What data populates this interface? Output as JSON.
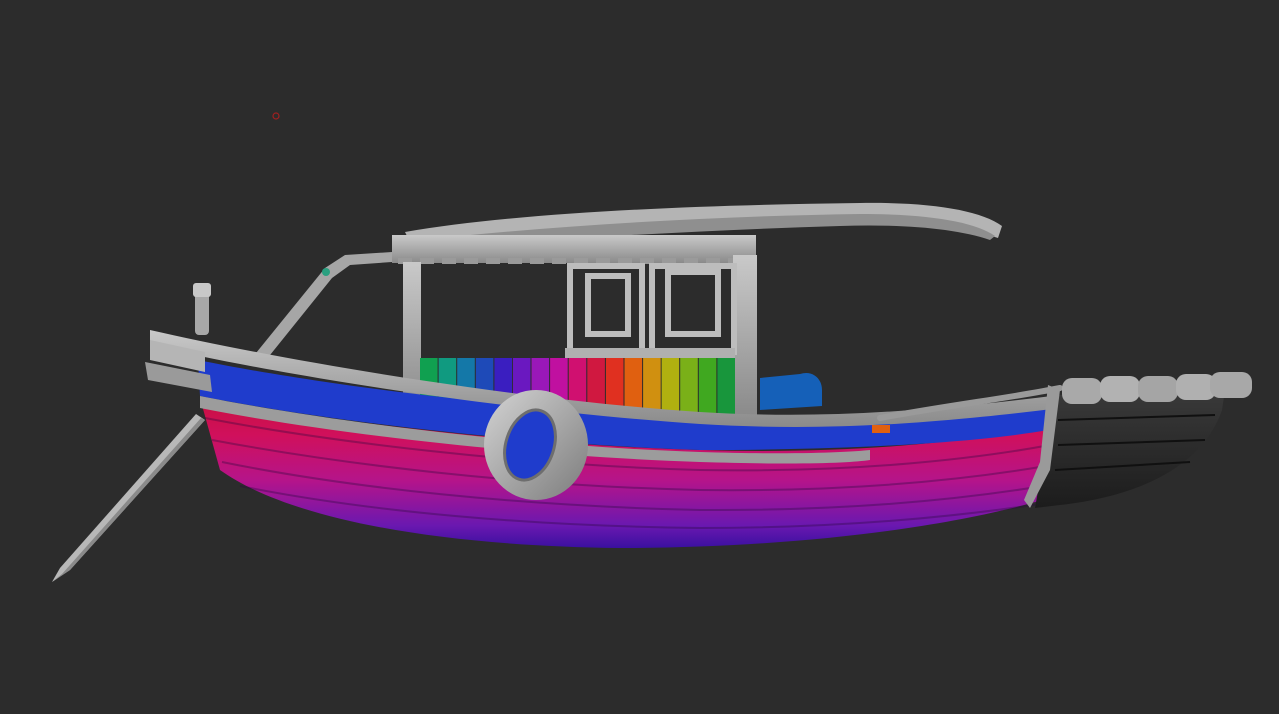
{
  "viewport": {
    "background_color": "#2c2c2c",
    "cursor_marker_color": "#a02020"
  },
  "model": {
    "subject": "fishing-boat",
    "material": "grey-clay",
    "polygroup_colors": {
      "hull_purple": "#7a1aa8",
      "hull_magenta": "#c8127a",
      "hull_pink": "#d0105c",
      "hull_red": "#c81040",
      "gunwale_blue": "#1f3ccc",
      "stern_dark": "#2a2a2a",
      "clay": "#a8a8a8",
      "seat_blue": "#1560b8"
    },
    "cabin_panel_colors": [
      "#10a050",
      "#109a80",
      "#1478a8",
      "#1e4ab8",
      "#3a1ec0",
      "#6a18c0",
      "#9a18b8",
      "#c010a0",
      "#d01070",
      "#d01840",
      "#e03020",
      "#e06010",
      "#d09010",
      "#b0b010",
      "#7ab018",
      "#40a820",
      "#18963c"
    ]
  }
}
